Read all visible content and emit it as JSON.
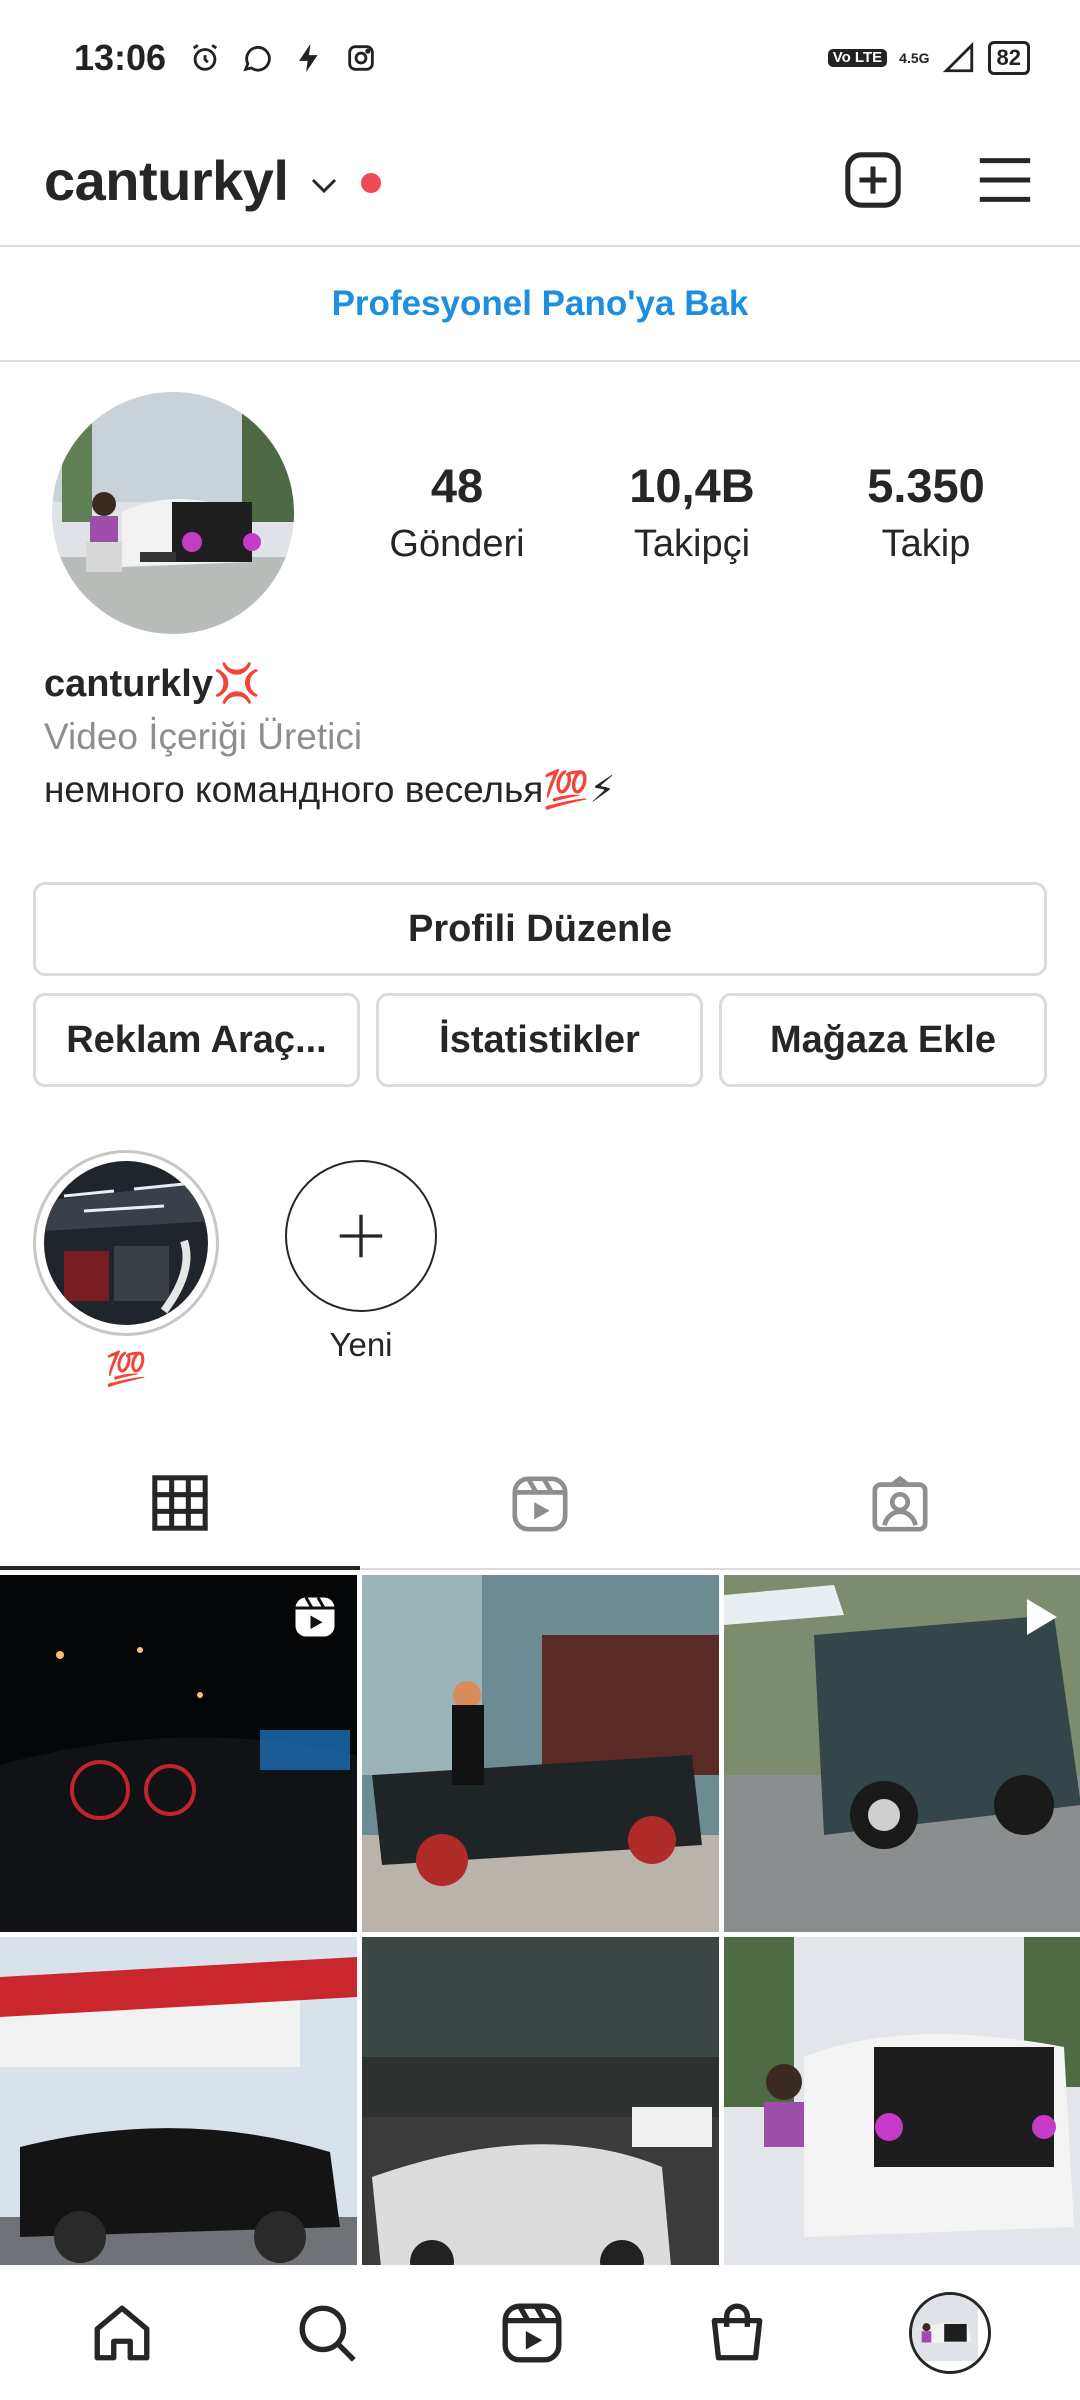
{
  "status_bar": {
    "time": "13:06",
    "network": "4.5G",
    "volte": "Vo LTE",
    "battery": "82"
  },
  "header": {
    "username": "canturkyl",
    "icons": [
      "chevron-down-icon",
      "notification-dot",
      "new-post-icon",
      "menu-icon"
    ]
  },
  "pro_dashboard": {
    "label": "Profesyonel Pano'ya Bak"
  },
  "profile": {
    "stats": [
      {
        "value": "48",
        "label": "Gönderi"
      },
      {
        "value": "10,4B",
        "label": "Takipçi"
      },
      {
        "value": "5.350",
        "label": "Takip"
      }
    ],
    "display_name": "canturkly💢",
    "category": "Video İçeriği Üretici",
    "bio": "немного командного веселья💯⚡"
  },
  "buttons": {
    "edit_profile": "Profili Düzenle",
    "ad_tools": "Reklam Araç...",
    "insights": "İstatistikler",
    "add_shop": "Mağaza Ekle"
  },
  "highlights": [
    {
      "label": "💯"
    },
    {
      "label": "Yeni"
    }
  ],
  "tabs": [
    "grid-icon",
    "reels-icon",
    "tagged-icon"
  ],
  "bottom_nav": [
    "home-icon",
    "search-icon",
    "reels-icon",
    "shop-icon",
    "profile-avatar"
  ],
  "colors": {
    "accent_blue": "#1d8fe0",
    "notification_red": "#ed4956",
    "text": "#262626",
    "muted": "#8e8e8e",
    "border": "#dbdbdb"
  }
}
